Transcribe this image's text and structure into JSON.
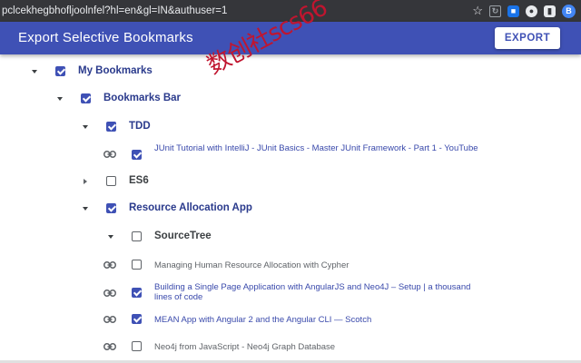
{
  "browser": {
    "url": "pclcekhegbhofljoolnfel?hl=en&gl=IN&authuser=1",
    "icons": [
      "star-icon",
      "extension-icon",
      "extension-icon",
      "extension-icon",
      "extension-icon",
      "extension-icon"
    ]
  },
  "header": {
    "title": "Export Selective Bookmarks",
    "export_label": "EXPORT",
    "color": "#3f51b5"
  },
  "watermark": {
    "text": "数创社scs66"
  },
  "tree": {
    "my_bookmarks": "My Bookmarks",
    "bookmarks_bar": "Bookmarks Bar",
    "tdd": "TDD",
    "junit": "JUnit Tutorial with IntelliJ - JUnit Basics - Master JUnit Framework - Part 1 - YouTube",
    "es6": "ES6",
    "resource_app": "Resource Allocation App",
    "sourcetree": "SourceTree",
    "managing": "Managing Human Resource Allocation with Cypher",
    "building": "Building a Single Page Application with AngularJS and Neo4J – Setup | a thousand lines of code",
    "mean": "MEAN App with Angular 2 and the Angular CLI — Scotch",
    "neo4j": "Neo4j from JavaScript - Neo4j Graph Database"
  },
  "state": {
    "checked": [
      "My Bookmarks",
      "Bookmarks Bar",
      "TDD",
      "JUnit Tutorial",
      "Resource Allocation App",
      "Building a Single Page Application",
      "MEAN App"
    ],
    "unchecked": [
      "ES6",
      "SourceTree",
      "Managing Human Resource Allocation",
      "Neo4j from JavaScript"
    ]
  }
}
